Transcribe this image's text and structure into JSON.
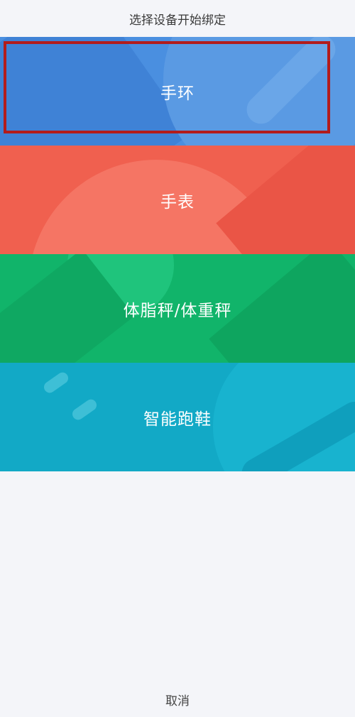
{
  "header": {
    "title": "选择设备开始绑定"
  },
  "devices": [
    {
      "label": "手环",
      "color": "#4a8fe0"
    },
    {
      "label": "手表",
      "color": "#f0604f"
    },
    {
      "label": "体脂秤/体重秤",
      "color": "#11b46a"
    },
    {
      "label": "智能跑鞋",
      "color": "#12a9c6"
    }
  ],
  "selection": {
    "color": "#b21c1c"
  },
  "footer": {
    "cancel_label": "取消"
  }
}
